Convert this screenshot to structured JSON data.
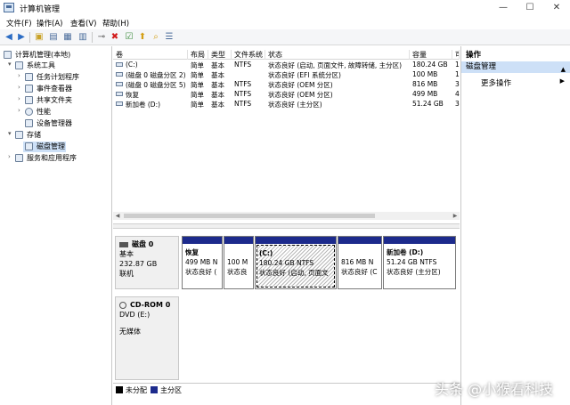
{
  "window": {
    "title": "计算机管理",
    "minimize": "—",
    "maximize": "☐",
    "close": "✕"
  },
  "menu": [
    "文件(F)",
    "操作(A)",
    "查看(V)",
    "帮助(H)"
  ],
  "tree": [
    {
      "label": "计算机管理(本地)",
      "level": 0,
      "exp": ""
    },
    {
      "label": "系统工具",
      "level": 1,
      "exp": "▾"
    },
    {
      "label": "任务计划程序",
      "level": 2,
      "exp": "›"
    },
    {
      "label": "事件查看器",
      "level": 2,
      "exp": "›"
    },
    {
      "label": "共享文件夹",
      "level": 2,
      "exp": "›"
    },
    {
      "label": "性能",
      "level": 2,
      "exp": "›"
    },
    {
      "label": "设备管理器",
      "level": 2,
      "exp": ""
    },
    {
      "label": "存储",
      "level": 1,
      "exp": "▾"
    },
    {
      "label": "磁盘管理",
      "level": 2,
      "exp": "",
      "selected": true
    },
    {
      "label": "服务和应用程序",
      "level": 1,
      "exp": "›"
    }
  ],
  "columns": [
    "卷",
    "布局",
    "类型",
    "文件系统",
    "状态",
    "容量",
    "可"
  ],
  "volumes": [
    [
      "(C:)",
      "简单",
      "基本",
      "NTFS",
      "状态良好 (启动, 页面文件, 故障转储, 主分区)",
      "180.24 GB",
      "1"
    ],
    [
      "(磁盘 0 磁盘分区 2)",
      "简单",
      "基本",
      "",
      "状态良好 (EFI 系统分区)",
      "100 MB",
      "1"
    ],
    [
      "(磁盘 0 磁盘分区 5)",
      "简单",
      "基本",
      "NTFS",
      "状态良好 (OEM 分区)",
      "816 MB",
      "3"
    ],
    [
      "恢复",
      "简单",
      "基本",
      "NTFS",
      "状态良好 (OEM 分区)",
      "499 MB",
      "4"
    ],
    [
      "新加卷 (D:)",
      "简单",
      "基本",
      "NTFS",
      "状态良好 (主分区)",
      "51.24 GB",
      "3"
    ]
  ],
  "disk0": {
    "name": "磁盘 0",
    "type": "基本",
    "size": "232.87 GB",
    "status": "联机",
    "partitions": [
      {
        "title": "恢复",
        "size": "499 MB N",
        "status": "状态良好 ("
      },
      {
        "title": "",
        "size": "100 M",
        "status": "状态良"
      },
      {
        "title": "(C:)",
        "size": "180.24 GB NTFS",
        "status": "状态良好 (启动, 页面文",
        "selected": true
      },
      {
        "title": "",
        "size": "816 MB N",
        "status": "状态良好 (C"
      },
      {
        "title": "新加卷 (D:)",
        "size": "51.24 GB NTFS",
        "status": "状态良好 (主分区)"
      }
    ]
  },
  "cdrom": {
    "name": "CD-ROM 0",
    "drive": "DVD (E:)",
    "media": "无媒体"
  },
  "legend": [
    {
      "label": "未分配",
      "color": "#000000"
    },
    {
      "label": "主分区",
      "color": "#1c2a8c"
    }
  ],
  "actions": {
    "header": "操作",
    "section": "磁盘管理",
    "more": "更多操作"
  },
  "watermark": "头条 @小猴看科技"
}
